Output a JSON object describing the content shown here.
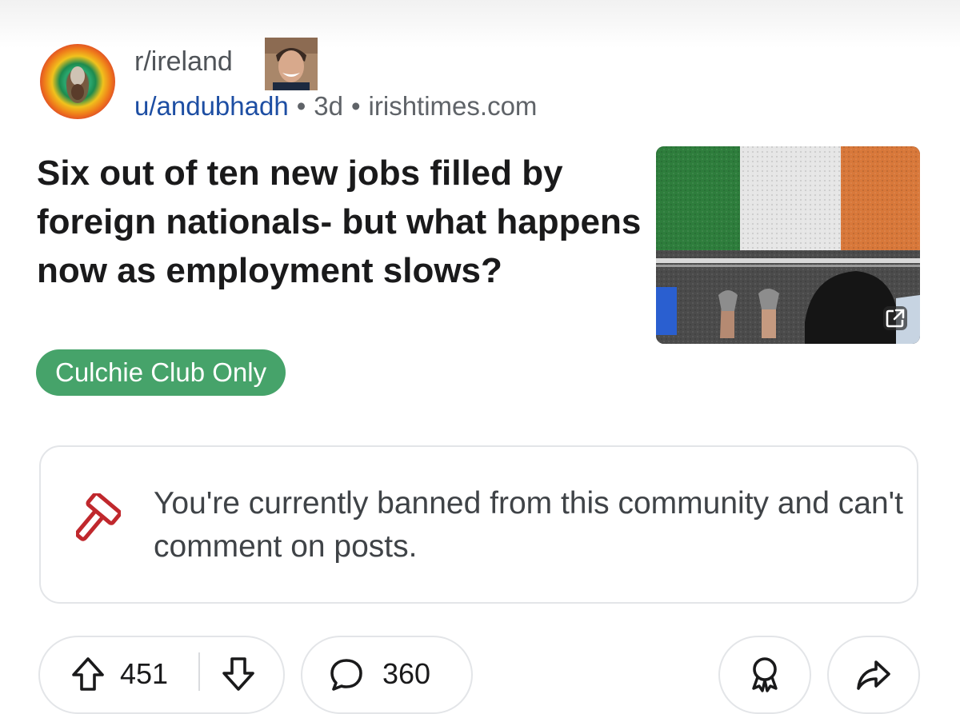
{
  "post": {
    "subreddit": "r/ireland",
    "author": "u/andubhadh",
    "age": "3d",
    "domain": "irishtimes.com",
    "separator": "•",
    "title": "Six out of ten new jobs filled by foreign nationals- but what happens now as employment slows?",
    "flair": "Culchie Club Only",
    "flair_color": "#46a36a"
  },
  "banned_notice": {
    "text": "You're currently banned from this community and can't comment on posts.",
    "icon": "gavel-icon",
    "icon_color": "#c0282d"
  },
  "actions": {
    "upvotes": "451",
    "comments": "360",
    "upvote_icon": "upvote-arrow-icon",
    "downvote_icon": "downvote-arrow-icon",
    "comment_icon": "comment-bubble-icon",
    "award_icon": "award-icon",
    "share_icon": "share-arrow-icon"
  },
  "thumbnail": {
    "description_icon": "external-link-icon",
    "flag_colors": [
      "#2e7d3c",
      "#e6e6e6",
      "#d8783a"
    ]
  }
}
